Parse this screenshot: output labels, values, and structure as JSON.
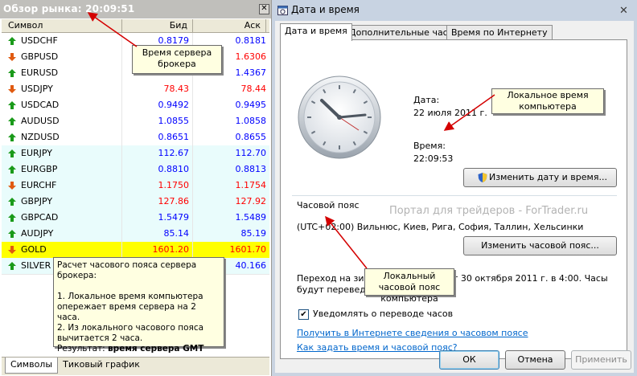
{
  "market_watch": {
    "title": "Обзор рынка: 20:09:51",
    "columns": {
      "symbol": "Символ",
      "bid": "Бид",
      "ask": "Аск"
    },
    "rows": [
      {
        "symbol": "USDCHF",
        "bid": "0.8179",
        "ask": "0.8181",
        "dir": "up",
        "color": "#0000ff",
        "bg": "#ffffff"
      },
      {
        "symbol": "GBPUSD",
        "bid": "",
        "ask": "1.6306",
        "dir": "down",
        "color": "#ff0000",
        "bg": "#ffffff"
      },
      {
        "symbol": "EURUSD",
        "bid": "",
        "ask": "1.4367",
        "dir": "up",
        "color": "#0000ff",
        "bg": "#ffffff"
      },
      {
        "symbol": "USDJPY",
        "bid": "78.43",
        "ask": "78.44",
        "dir": "down",
        "color": "#ff0000",
        "bg": "#ffffff"
      },
      {
        "symbol": "USDCAD",
        "bid": "0.9492",
        "ask": "0.9495",
        "dir": "up",
        "color": "#0000ff",
        "bg": "#ffffff"
      },
      {
        "symbol": "AUDUSD",
        "bid": "1.0855",
        "ask": "1.0858",
        "dir": "up",
        "color": "#0000ff",
        "bg": "#ffffff"
      },
      {
        "symbol": "NZDUSD",
        "bid": "0.8651",
        "ask": "0.8655",
        "dir": "up",
        "color": "#0000ff",
        "bg": "#ffffff"
      },
      {
        "symbol": "EURJPY",
        "bid": "112.67",
        "ask": "112.70",
        "dir": "up",
        "color": "#0000ff",
        "bg": "#e9fcfc"
      },
      {
        "symbol": "EURGBP",
        "bid": "0.8810",
        "ask": "0.8813",
        "dir": "up",
        "color": "#0000ff",
        "bg": "#e9fcfc"
      },
      {
        "symbol": "EURCHF",
        "bid": "1.1750",
        "ask": "1.1754",
        "dir": "down",
        "color": "#ff0000",
        "bg": "#e9fcfc"
      },
      {
        "symbol": "GBPJPY",
        "bid": "127.86",
        "ask": "127.92",
        "dir": "up",
        "color": "#ff0000",
        "bg": "#e9fcfc"
      },
      {
        "symbol": "GBPCAD",
        "bid": "1.5479",
        "ask": "1.5489",
        "dir": "up",
        "color": "#0000ff",
        "bg": "#e9fcfc"
      },
      {
        "symbol": "AUDJPY",
        "bid": "85.14",
        "ask": "85.19",
        "dir": "up",
        "color": "#0000ff",
        "bg": "#e9fcfc"
      },
      {
        "symbol": "GOLD",
        "bid": "1601.20",
        "ask": "1601.70",
        "dir": "down",
        "color": "#ff0000",
        "bg": "#ffff00"
      },
      {
        "symbol": "SILVER",
        "bid": "",
        "ask": "40.166",
        "dir": "up",
        "color": "#0000ff",
        "bg": "#e9fcfc"
      }
    ],
    "tabs": [
      "Символы",
      "Тиковый график"
    ],
    "callout_server": "Время сервера брокера",
    "note": {
      "line1": "Расчет часового пояса сервера брокера:",
      "line2": "1. Локальное время компьютера опережает время сервера на 2 часа.",
      "line3": "2. Из локального часового пояса вычитается 2 часа.",
      "result_label": "Результат: ",
      "result_value": "время сервера GMT"
    }
  },
  "dialog": {
    "title": "Дата и время",
    "close_glyph": "✕",
    "tabs": [
      "Дата и время",
      "Дополнительные часы",
      "Время по Интернету"
    ],
    "date_label": "Дата:",
    "date_value": "22 июля 2011 г.",
    "time_label": "Время:",
    "time_value": "22:09:53",
    "change_datetime_btn": "Изменить дату и время...",
    "timezone_label": "Часовой пояс",
    "timezone_value": "(UTC+02:00) Вильнюс, Киев, Рига, София, Таллин, Хельсинки",
    "change_timezone_btn": "Изменить часовой пояс...",
    "dst_text_1": "Переход на зи",
    "dst_text_2": "т 30 октября 2011 г. в 4:00. Часы",
    "dst_text_3": "будут переведе",
    "notify_label": "Уведомлять о переводе часов",
    "notify_checked": true,
    "link1": "Получить в Интернете сведения о часовом поясе",
    "link2": "Как задать время и часовой пояс?",
    "ok": "ОК",
    "cancel": "Отмена",
    "apply": "Применить",
    "watermark": "Портал для трейдеров - ForTrader.ru",
    "callout_local_time": "Локальное время компьютера",
    "callout_local_tz": "Локальный часовой пояс компьютера"
  },
  "colors": {
    "up": "#1a9a1a",
    "down": "#e05a10",
    "arrow": "#d40000"
  }
}
